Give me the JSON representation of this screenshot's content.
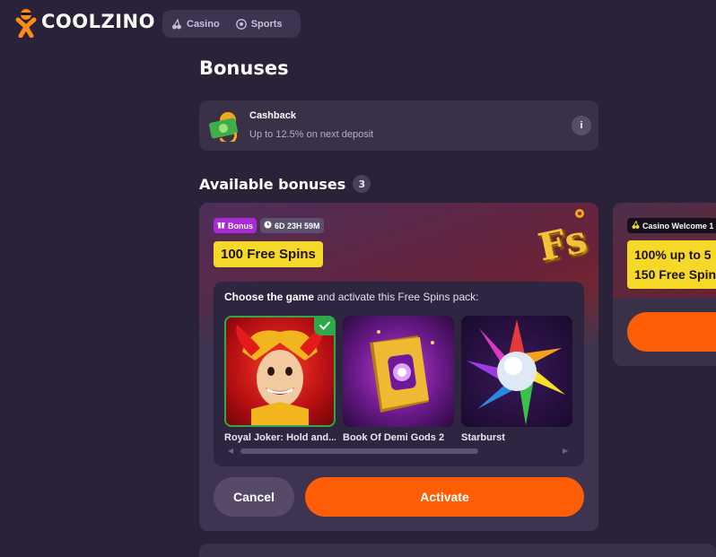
{
  "brand": {
    "name": "COOLZINO"
  },
  "nav": {
    "items": [
      {
        "label": "Casino",
        "icon": "cherries-icon"
      },
      {
        "label": "Sports",
        "icon": "soccer-ball-icon"
      }
    ]
  },
  "page": {
    "title": "Bonuses"
  },
  "cashback": {
    "title": "Cashback",
    "subtitle": "Up to 12.5% on next deposit",
    "info_label": "i"
  },
  "available": {
    "title": "Available bonuses",
    "count": "3"
  },
  "bonus_card": {
    "tag_bonus": "Bonus",
    "tag_timer": "6D 23H 59M",
    "label": "100 Free Spins",
    "prompt_bold": "Choose the game",
    "prompt_rest": " and activate this Free Spins pack:",
    "games": [
      {
        "name": "Royal Joker: Hold and...",
        "selected": true
      },
      {
        "name": "Book Of Demi Gods 2",
        "selected": false
      },
      {
        "name": "Starburst",
        "selected": false
      }
    ],
    "cancel_label": "Cancel",
    "activate_label": "Activate"
  },
  "second_card": {
    "tag": "Casino Welcome 1",
    "label_line1": "100% up to 5",
    "label_line2": "150 Free Spin"
  },
  "colors": {
    "background": "#2a2238",
    "accent_orange": "#ff5e06",
    "label_yellow": "#f6d928",
    "bonus_tag_purple": "#a82bd6",
    "selected_green": "#2fa84a"
  }
}
